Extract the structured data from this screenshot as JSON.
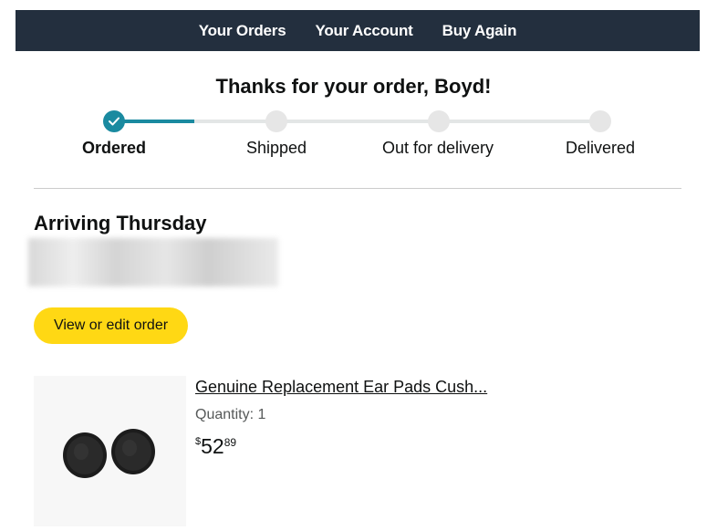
{
  "nav": {
    "items": [
      {
        "label": "Your Orders"
      },
      {
        "label": "Your Account"
      },
      {
        "label": "Buy Again"
      }
    ]
  },
  "header": {
    "title": "Thanks for your order, Boyd!"
  },
  "tracker": {
    "steps": [
      {
        "label": "Ordered",
        "status": "complete"
      },
      {
        "label": "Shipped",
        "status": "pending"
      },
      {
        "label": "Out for delivery",
        "status": "pending"
      },
      {
        "label": "Delivered",
        "status": "pending"
      }
    ],
    "accent_color": "#1a8aa0"
  },
  "delivery": {
    "arriving_text": "Arriving Thursday"
  },
  "actions": {
    "view_edit_label": "View or edit order",
    "button_color": "#ffd814"
  },
  "product": {
    "name": "Genuine Replacement Ear Pads Cush...",
    "quantity_text": "Quantity: 1",
    "price_symbol": "$",
    "price_whole": "52",
    "price_fraction": "89",
    "image_icon": "ear-pads-image"
  },
  "colors": {
    "nav_bg": "#232f3e"
  }
}
